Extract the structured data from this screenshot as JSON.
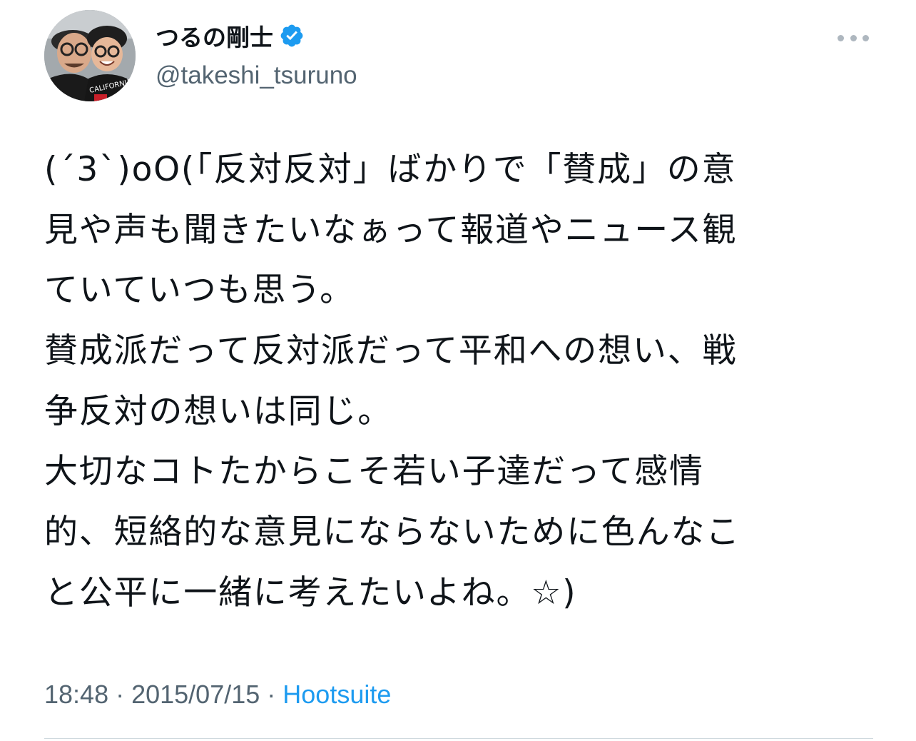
{
  "author": {
    "display_name": "つるの剛士",
    "handle": "@takeshi_tsuruno",
    "verified": true,
    "avatar_icon": "profile-photo",
    "avatar_shirt_text": "CALIFORNIA"
  },
  "more_icon": "ellipsis-icon",
  "tweet": {
    "lines": [
      "(´3`)oO(「反対反対」ばかりで「賛成」の意",
      "見や声も聞きたいなぁって報道やニュース観",
      "ていていつも思う。",
      "賛成派だって反対派だって平和への想い、戦",
      "争反対の想いは同じ。",
      "大切なコトたからこそ若い子達だって感情",
      "的、短絡的な意見にならないために色んなこ",
      "と公平に一緒に考えたいよね。☆)"
    ]
  },
  "meta": {
    "time": "18:48",
    "separator": " · ",
    "date": "2015/07/15",
    "source": "Hootsuite"
  },
  "colors": {
    "verified_badge": "#1d9bf0",
    "secondary_text": "#536471",
    "link": "#1d9bf0",
    "primary_text": "#0f1419"
  }
}
